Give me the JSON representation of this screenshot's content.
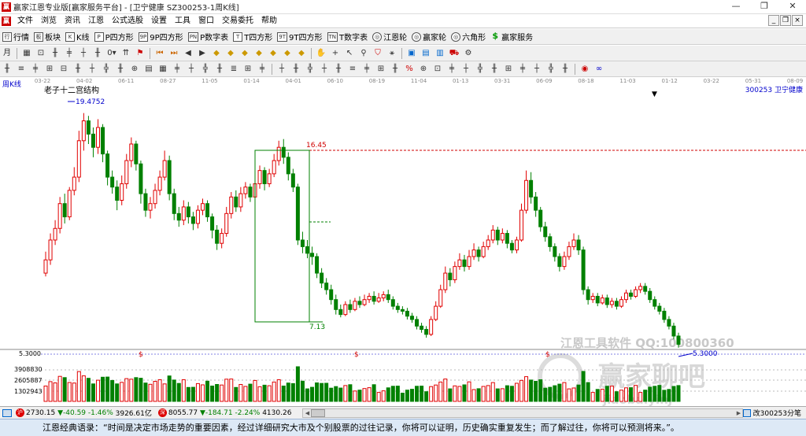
{
  "window": {
    "title": "赢家江恩专业版[赢家服务平台] - [卫宁健康  SZ300253-1周K线]"
  },
  "menu": [
    "文件",
    "浏览",
    "资讯",
    "江恩",
    "公式选股",
    "设置",
    "工具",
    "窗口",
    "交易委托",
    "帮助"
  ],
  "toolbar_main": [
    {
      "icon": "行",
      "label": "行情"
    },
    {
      "icon": "板",
      "label": "板块"
    },
    {
      "icon": "K",
      "label": "K线"
    },
    {
      "icon": "P",
      "label": "P四方形"
    },
    {
      "icon": "9P",
      "label": "9P四方形"
    },
    {
      "icon": "PN",
      "label": "P数字表"
    },
    {
      "icon": "T",
      "label": "T四方形"
    },
    {
      "icon": "9T",
      "label": "9T四方形"
    },
    {
      "icon": "TN",
      "label": "T数字表"
    },
    {
      "icon": "◎",
      "label": "江恩轮"
    },
    {
      "icon": "◎",
      "label": "赢家轮"
    },
    {
      "icon": "◎",
      "label": "六角形"
    },
    {
      "icon": "$",
      "label": "赢家服务"
    }
  ],
  "chart": {
    "period_label": "周K线",
    "structure_label": "老子十二宫结构",
    "stock_label": "300253  卫宁健康",
    "high_label": "19.4752",
    "resistance_label": "16.45",
    "box_label": "7.13",
    "low_label": "5.3000",
    "price_axis_label": "5.3000",
    "volume_axis_labels": [
      "3908830",
      "2605887",
      "1302943"
    ],
    "date_labels": [
      "03-22",
      "04-02",
      "06-11",
      "08-27",
      "11-05",
      "01-14",
      "04-01",
      "06-10",
      "08-19",
      "11-04",
      "01-13",
      "03-31",
      "06-09",
      "08-18",
      "11-03",
      "01-12",
      "03-22",
      "05-31",
      "08-09"
    ],
    "dividend_marker": "$",
    "watermark_lines": [
      "江恩工具软件  QQ:100800360",
      "赢家聊吧",
      "jiaoba.yinj"
    ]
  },
  "chart_data": {
    "type": "candlestick",
    "title": "周K线",
    "symbol": "300253 卫宁健康",
    "annotations": [
      "19.4752",
      "16.45",
      "7.13",
      "5.3000"
    ],
    "candles": [
      [
        9.8,
        10.6,
        11.1,
        9.6
      ],
      [
        10.6,
        11.8,
        12.2,
        10.3
      ],
      [
        11.8,
        12.5,
        13.0,
        11.5
      ],
      [
        12.5,
        14.0,
        14.4,
        12.2
      ],
      [
        14.0,
        13.2,
        14.6,
        12.8
      ],
      [
        13.2,
        14.8,
        15.0,
        13.0
      ],
      [
        14.8,
        15.6,
        16.2,
        14.5
      ],
      [
        15.6,
        17.8,
        18.4,
        15.3
      ],
      [
        17.8,
        19.0,
        19.47,
        17.2
      ],
      [
        19.0,
        18.2,
        19.3,
        17.6
      ],
      [
        18.2,
        17.4,
        18.6,
        16.8
      ],
      [
        17.4,
        18.6,
        19.1,
        17.0
      ],
      [
        18.6,
        17.0,
        18.8,
        16.5
      ],
      [
        17.0,
        15.6,
        17.2,
        15.1
      ],
      [
        15.6,
        15.0,
        16.0,
        14.6
      ],
      [
        15.0,
        14.2,
        15.4,
        13.6
      ],
      [
        14.2,
        15.2,
        15.7,
        13.9
      ],
      [
        15.2,
        16.6,
        17.0,
        14.9
      ],
      [
        16.6,
        17.6,
        18.0,
        16.2
      ],
      [
        17.6,
        16.4,
        17.8,
        16.0
      ],
      [
        16.4,
        14.6,
        16.6,
        14.0
      ],
      [
        14.6,
        13.6,
        14.9,
        13.2
      ],
      [
        13.6,
        14.0,
        14.4,
        13.1
      ],
      [
        14.0,
        14.8,
        15.2,
        13.7
      ],
      [
        14.8,
        15.6,
        16.0,
        14.5
      ],
      [
        15.6,
        16.6,
        17.2,
        15.4
      ],
      [
        16.6,
        14.6,
        16.9,
        14.2
      ],
      [
        14.6,
        13.4,
        14.9,
        13.0
      ],
      [
        13.4,
        13.0,
        13.8,
        12.6
      ],
      [
        13.0,
        13.8,
        14.2,
        12.7
      ],
      [
        13.8,
        13.2,
        14.1,
        12.8
      ],
      [
        13.2,
        12.8,
        13.5,
        12.4
      ],
      [
        12.8,
        13.6,
        13.9,
        12.5
      ],
      [
        13.6,
        14.0,
        14.3,
        13.3
      ],
      [
        14.0,
        13.2,
        14.2,
        12.9
      ],
      [
        13.2,
        12.4,
        13.4,
        11.9
      ],
      [
        12.4,
        11.6,
        12.7,
        11.2
      ],
      [
        11.6,
        12.2,
        12.5,
        11.3
      ],
      [
        12.2,
        13.4,
        13.8,
        12.0
      ],
      [
        13.4,
        14.4,
        14.7,
        13.1
      ],
      [
        14.4,
        13.8,
        14.8,
        13.5
      ],
      [
        13.8,
        14.6,
        15.0,
        13.5
      ],
      [
        14.6,
        15.0,
        15.3,
        14.3
      ],
      [
        15.0,
        14.4,
        15.2,
        14.1
      ],
      [
        14.4,
        15.2,
        15.6,
        14.2
      ],
      [
        15.2,
        16.0,
        16.3,
        14.9
      ],
      [
        16.0,
        15.2,
        16.2,
        14.8
      ],
      [
        15.2,
        15.8,
        16.1,
        15.0
      ],
      [
        15.8,
        16.6,
        17.0,
        15.6
      ],
      [
        16.6,
        17.4,
        17.8,
        16.3
      ],
      [
        17.4,
        16.8,
        17.9,
        16.4
      ],
      [
        16.8,
        15.8,
        17.1,
        15.4
      ],
      [
        15.8,
        15.0,
        16.1,
        14.7
      ],
      [
        15.0,
        11.8,
        15.2,
        11.5
      ],
      [
        11.8,
        11.4,
        12.3,
        11.0
      ],
      [
        11.4,
        11.0,
        11.8,
        10.7
      ],
      [
        11.0,
        10.8,
        11.4,
        10.3
      ],
      [
        10.8,
        9.8,
        11.0,
        9.5
      ],
      [
        9.8,
        9.2,
        10.1,
        8.9
      ],
      [
        9.2,
        8.8,
        9.5,
        8.5
      ],
      [
        8.8,
        8.2,
        9.1,
        7.9
      ],
      [
        8.2,
        7.6,
        8.5,
        7.3
      ],
      [
        7.6,
        7.3,
        7.9,
        7.13
      ],
      [
        7.3,
        7.9,
        8.1,
        7.2
      ],
      [
        7.9,
        7.6,
        8.2,
        7.4
      ],
      [
        7.6,
        8.1,
        8.3,
        7.5
      ],
      [
        8.1,
        7.9,
        8.4,
        7.7
      ],
      [
        7.9,
        8.2,
        8.5,
        7.8
      ],
      [
        8.2,
        8.4,
        8.6,
        8.0
      ],
      [
        8.4,
        8.1,
        8.7,
        7.9
      ],
      [
        8.1,
        8.3,
        8.6,
        8.0
      ],
      [
        8.3,
        8.5,
        8.7,
        8.1
      ],
      [
        8.5,
        8.2,
        8.8,
        8.0
      ],
      [
        8.2,
        7.8,
        8.4,
        7.6
      ],
      [
        7.8,
        7.6,
        8.0,
        7.4
      ],
      [
        7.6,
        7.5,
        7.8,
        7.3
      ],
      [
        7.5,
        7.2,
        7.7,
        7.0
      ],
      [
        7.2,
        7.0,
        7.4,
        6.8
      ],
      [
        7.0,
        6.6,
        7.2,
        6.4
      ],
      [
        6.6,
        6.4,
        6.8,
        6.2
      ],
      [
        6.4,
        6.1,
        6.6,
        5.9
      ],
      [
        6.1,
        7.0,
        7.2,
        6.0
      ],
      [
        7.0,
        7.8,
        8.1,
        6.9
      ],
      [
        7.8,
        8.8,
        9.1,
        7.7
      ],
      [
        8.8,
        9.8,
        10.2,
        8.6
      ],
      [
        9.8,
        9.4,
        10.1,
        9.0
      ],
      [
        9.4,
        10.2,
        10.5,
        9.2
      ],
      [
        10.2,
        10.6,
        11.0,
        10.0
      ],
      [
        10.6,
        10.2,
        10.9,
        9.9
      ],
      [
        10.2,
        10.8,
        11.2,
        10.0
      ],
      [
        10.8,
        11.2,
        11.6,
        10.6
      ],
      [
        11.2,
        10.8,
        11.4,
        10.5
      ],
      [
        10.8,
        11.4,
        11.7,
        10.7
      ],
      [
        11.4,
        11.8,
        12.1,
        11.2
      ],
      [
        11.8,
        12.4,
        12.7,
        11.6
      ],
      [
        12.4,
        11.8,
        12.6,
        11.5
      ],
      [
        11.8,
        12.2,
        12.5,
        11.6
      ],
      [
        12.2,
        11.6,
        12.4,
        11.3
      ],
      [
        11.6,
        11.2,
        11.8,
        11.0
      ],
      [
        11.2,
        11.8,
        12.0,
        11.0
      ],
      [
        11.8,
        13.6,
        14.0,
        11.7
      ],
      [
        13.6,
        15.4,
        16.0,
        13.4
      ],
      [
        15.4,
        14.4,
        15.9,
        14.0
      ],
      [
        14.4,
        13.6,
        14.7,
        13.2
      ],
      [
        13.6,
        12.6,
        13.8,
        12.3
      ],
      [
        12.6,
        12.0,
        12.9,
        11.7
      ],
      [
        12.0,
        11.4,
        12.2,
        11.1
      ],
      [
        11.4,
        10.8,
        11.6,
        10.5
      ],
      [
        10.8,
        10.2,
        11.0,
        9.9
      ],
      [
        10.2,
        10.8,
        11.1,
        10.0
      ],
      [
        10.8,
        11.4,
        11.7,
        10.6
      ],
      [
        11.4,
        11.8,
        12.2,
        11.2
      ],
      [
        11.8,
        11.2,
        12.1,
        10.9
      ],
      [
        11.2,
        8.8,
        11.4,
        8.5
      ],
      [
        8.8,
        8.2,
        9.0,
        7.9
      ],
      [
        8.2,
        8.4,
        8.6,
        8.0
      ],
      [
        8.4,
        8.0,
        8.6,
        7.8
      ],
      [
        8.0,
        8.3,
        8.5,
        7.9
      ],
      [
        8.3,
        7.9,
        8.5,
        7.7
      ],
      [
        7.9,
        8.1,
        8.3,
        7.7
      ],
      [
        8.1,
        7.8,
        8.3,
        7.6
      ],
      [
        7.8,
        8.2,
        8.4,
        7.7
      ],
      [
        8.2,
        8.6,
        8.8,
        8.0
      ],
      [
        8.6,
        8.4,
        8.8,
        8.2
      ],
      [
        8.4,
        8.8,
        9.0,
        8.3
      ],
      [
        8.8,
        9.0,
        9.2,
        8.6
      ],
      [
        9.0,
        8.7,
        9.2,
        8.5
      ],
      [
        8.7,
        8.2,
        8.9,
        8.0
      ],
      [
        8.2,
        7.8,
        8.4,
        7.6
      ],
      [
        7.8,
        7.5,
        8.0,
        7.3
      ],
      [
        7.5,
        7.0,
        7.7,
        6.8
      ],
      [
        7.0,
        6.6,
        7.2,
        6.4
      ],
      [
        6.6,
        6.0,
        6.8,
        5.8
      ],
      [
        6.0,
        5.5,
        6.2,
        5.3
      ]
    ],
    "volume_axis": [
      1302943,
      2605887,
      3908830
    ]
  },
  "status": {
    "idx1_badge": "沪",
    "idx1_value": "2730.15",
    "idx1_change": "▼-40.59",
    "idx1_pct": "-1.46%",
    "idx1_amount": "3926.61亿",
    "idx2_badge": "深",
    "idx2_value": "8055.77",
    "idx2_change": "▼-184.71",
    "idx2_pct": "-2.24%",
    "idx2_amount": "4130.26",
    "right_text": "改300253分笔"
  },
  "quote": "江恩经典语录：“时间是决定市场走势的重要因素，经过详细研究大市及个别股票的过往记录，你将可以证明，历史确实重复发生；而了解过往，你将可以预测将来。”。",
  "colors": {
    "up": "#e00000",
    "down": "#008000",
    "accent": "#0000c0"
  }
}
